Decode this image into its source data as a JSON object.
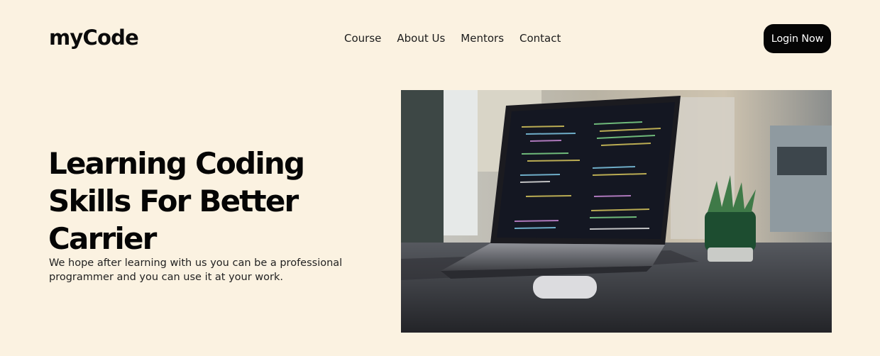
{
  "header": {
    "logo": "myCode",
    "nav": [
      "Course",
      "About Us",
      "Mentors",
      "Contact"
    ],
    "login_label": "Login Now"
  },
  "hero": {
    "title": "Learning Coding Skills For Better Carrier",
    "description": "We hope after learning with us you can be a professional programmer and you can use it at your work."
  },
  "colors": {
    "background": "#fbf2e1",
    "button": "#050505",
    "text": "#111111"
  }
}
